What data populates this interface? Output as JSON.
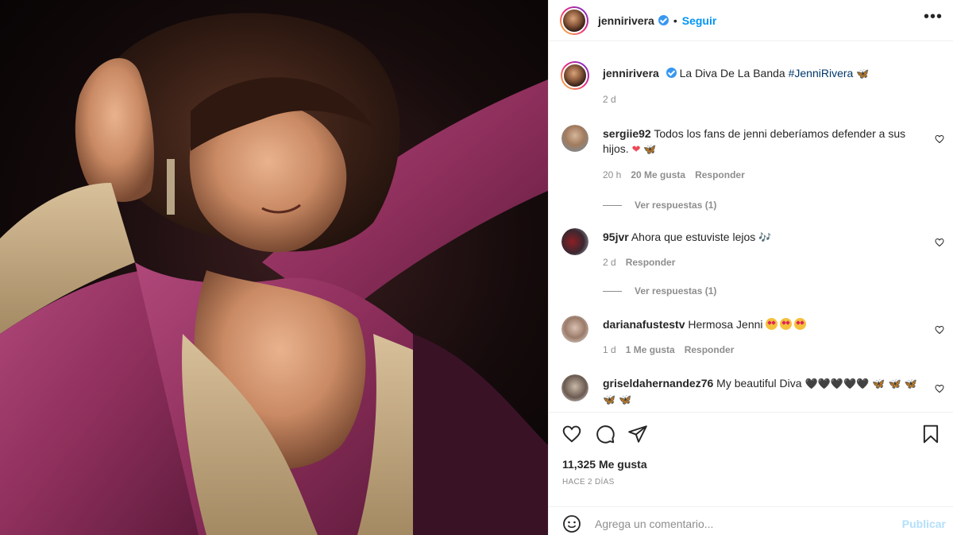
{
  "post": {
    "username": "jennirivera",
    "follow_label": "Seguir",
    "more_label": "•••",
    "caption_text": "La Diva De La Banda",
    "caption_hashtag": "#JenniRivera",
    "caption_emoji": "🦋",
    "caption_time": "2 d"
  },
  "comments": [
    {
      "user": "sergiie92",
      "text": "Todos los fans de jenni deberíamos defender a sus hijos.",
      "emoji": [
        "❤",
        "🦋"
      ],
      "time": "20 h",
      "likes": "20 Me gusta",
      "reply": "Responder",
      "view_replies": "Ver respuestas (1)"
    },
    {
      "user": "95jvr",
      "text": "Ahora que estuviste lejos",
      "emoji": [
        "🎶"
      ],
      "time": "2 d",
      "reply": "Responder",
      "view_replies": "Ver respuestas (1)"
    },
    {
      "user": "darianafustestv",
      "text": "Hermosa Jenni",
      "emoji": [
        "😍",
        "😍",
        "😍"
      ],
      "time": "1 d",
      "likes": "1 Me gusta",
      "reply": "Responder"
    },
    {
      "user": "griseldahernandez76",
      "text": "My beautiful Diva",
      "emoji": [
        "🖤🖤🖤🖤🖤",
        "🦋 🦋 🦋",
        "🦋 🦋"
      ]
    }
  ],
  "actions": {
    "likes_count": "11,325 Me gusta",
    "posted_ago": "HACE 2 DÍAS",
    "comment_placeholder": "Agrega un comentario...",
    "publish_label": "Publicar"
  },
  "icons": {
    "like": "heart-icon",
    "comment": "comment-bubble-icon",
    "share": "paper-plane-icon",
    "save": "bookmark-icon",
    "emoji": "smiley-icon",
    "more": "ellipsis-icon"
  },
  "colors": {
    "accent_blue": "#0095f6",
    "verified_blue": "#3897f0",
    "publish_disabled": "#b2dffc",
    "dress_magenta": "#8e2f5c"
  }
}
